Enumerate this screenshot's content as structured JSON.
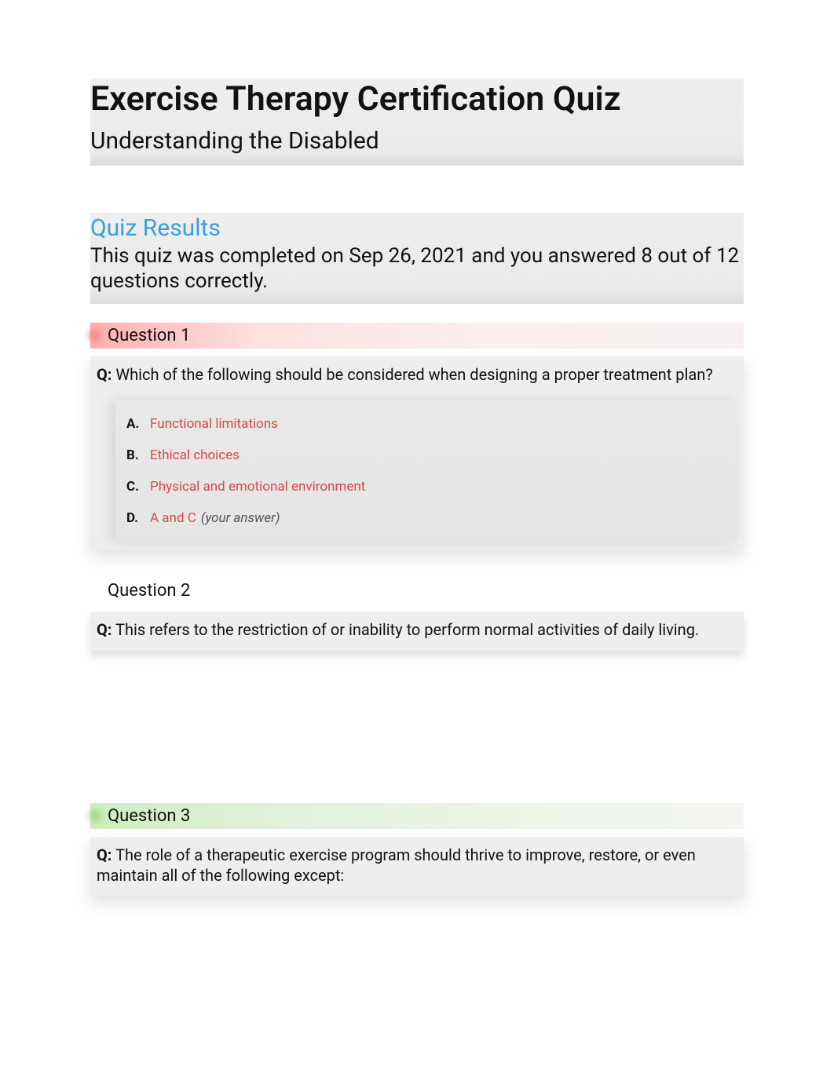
{
  "header": {
    "title": "Exercise Therapy Certification Quiz",
    "subtitle": "Understanding the Disabled"
  },
  "results": {
    "title": "Quiz Results",
    "summary": "This quiz was completed on Sep 26, 2021 and you answered 8 out of 12 questions correctly."
  },
  "questions": [
    {
      "label": "Question 1",
      "status": "incorrect",
      "prompt_prefix": "Q:",
      "prompt": "Which of the following should be considered when designing a proper treatment plan?",
      "answers": [
        {
          "letter": "A.",
          "text": "Functional limitations",
          "your_answer": false
        },
        {
          "letter": "B.",
          "text": "Ethical choices",
          "your_answer": false
        },
        {
          "letter": "C.",
          "text": "Physical and emotional environment",
          "your_answer": false
        },
        {
          "letter": "D.",
          "text": "A and C",
          "your_answer": true
        }
      ],
      "your_answer_label": "(your answer)"
    },
    {
      "label": "Question 2",
      "status": "neutral",
      "prompt_prefix": "Q:",
      "prompt": "This refers to the restriction of or inability to perform normal activities of daily living."
    },
    {
      "label": "Question 3",
      "status": "correct",
      "prompt_prefix": "Q:",
      "prompt": "The role of a therapeutic exercise program should thrive to improve, restore, or even maintain all of the following except:"
    }
  ]
}
